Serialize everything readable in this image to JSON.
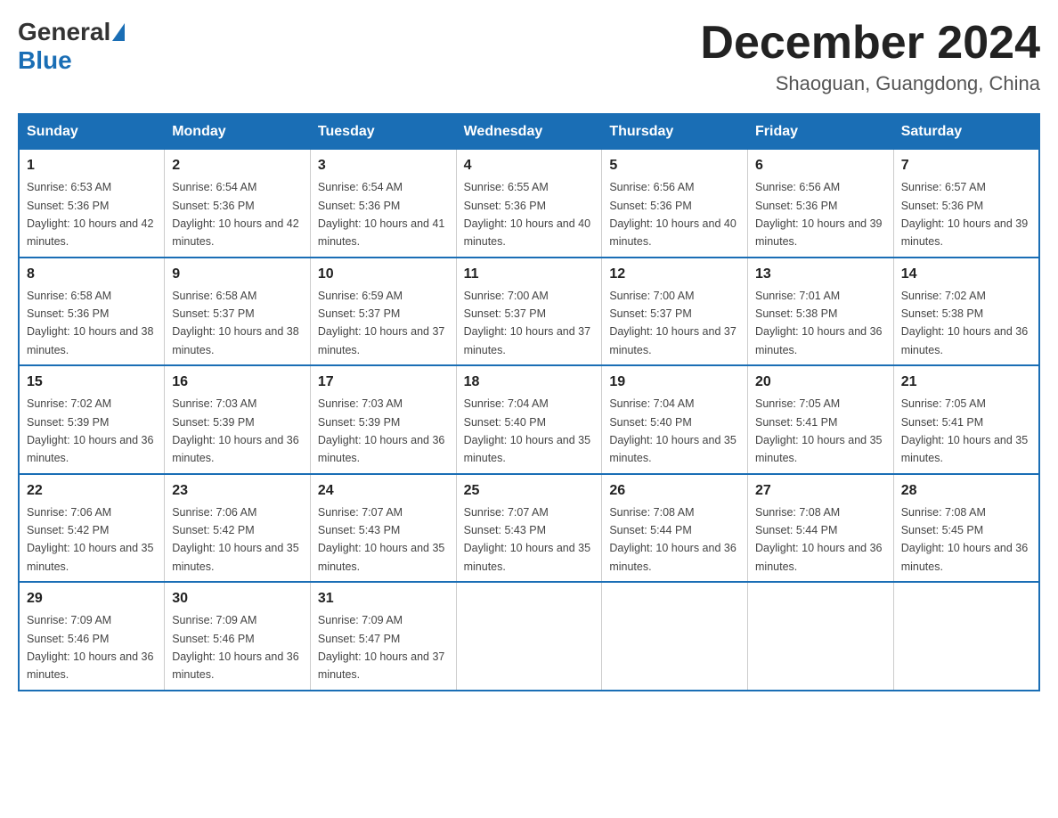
{
  "header": {
    "logo_general": "General",
    "logo_blue": "Blue",
    "title": "December 2024",
    "subtitle": "Shaoguan, Guangdong, China"
  },
  "days_of_week": [
    "Sunday",
    "Monday",
    "Tuesday",
    "Wednesday",
    "Thursday",
    "Friday",
    "Saturday"
  ],
  "weeks": [
    [
      {
        "day": "1",
        "sunrise": "6:53 AM",
        "sunset": "5:36 PM",
        "daylight": "10 hours and 42 minutes."
      },
      {
        "day": "2",
        "sunrise": "6:54 AM",
        "sunset": "5:36 PM",
        "daylight": "10 hours and 42 minutes."
      },
      {
        "day": "3",
        "sunrise": "6:54 AM",
        "sunset": "5:36 PM",
        "daylight": "10 hours and 41 minutes."
      },
      {
        "day": "4",
        "sunrise": "6:55 AM",
        "sunset": "5:36 PM",
        "daylight": "10 hours and 40 minutes."
      },
      {
        "day": "5",
        "sunrise": "6:56 AM",
        "sunset": "5:36 PM",
        "daylight": "10 hours and 40 minutes."
      },
      {
        "day": "6",
        "sunrise": "6:56 AM",
        "sunset": "5:36 PM",
        "daylight": "10 hours and 39 minutes."
      },
      {
        "day": "7",
        "sunrise": "6:57 AM",
        "sunset": "5:36 PM",
        "daylight": "10 hours and 39 minutes."
      }
    ],
    [
      {
        "day": "8",
        "sunrise": "6:58 AM",
        "sunset": "5:36 PM",
        "daylight": "10 hours and 38 minutes."
      },
      {
        "day": "9",
        "sunrise": "6:58 AM",
        "sunset": "5:37 PM",
        "daylight": "10 hours and 38 minutes."
      },
      {
        "day": "10",
        "sunrise": "6:59 AM",
        "sunset": "5:37 PM",
        "daylight": "10 hours and 37 minutes."
      },
      {
        "day": "11",
        "sunrise": "7:00 AM",
        "sunset": "5:37 PM",
        "daylight": "10 hours and 37 minutes."
      },
      {
        "day": "12",
        "sunrise": "7:00 AM",
        "sunset": "5:37 PM",
        "daylight": "10 hours and 37 minutes."
      },
      {
        "day": "13",
        "sunrise": "7:01 AM",
        "sunset": "5:38 PM",
        "daylight": "10 hours and 36 minutes."
      },
      {
        "day": "14",
        "sunrise": "7:02 AM",
        "sunset": "5:38 PM",
        "daylight": "10 hours and 36 minutes."
      }
    ],
    [
      {
        "day": "15",
        "sunrise": "7:02 AM",
        "sunset": "5:39 PM",
        "daylight": "10 hours and 36 minutes."
      },
      {
        "day": "16",
        "sunrise": "7:03 AM",
        "sunset": "5:39 PM",
        "daylight": "10 hours and 36 minutes."
      },
      {
        "day": "17",
        "sunrise": "7:03 AM",
        "sunset": "5:39 PM",
        "daylight": "10 hours and 36 minutes."
      },
      {
        "day": "18",
        "sunrise": "7:04 AM",
        "sunset": "5:40 PM",
        "daylight": "10 hours and 35 minutes."
      },
      {
        "day": "19",
        "sunrise": "7:04 AM",
        "sunset": "5:40 PM",
        "daylight": "10 hours and 35 minutes."
      },
      {
        "day": "20",
        "sunrise": "7:05 AM",
        "sunset": "5:41 PM",
        "daylight": "10 hours and 35 minutes."
      },
      {
        "day": "21",
        "sunrise": "7:05 AM",
        "sunset": "5:41 PM",
        "daylight": "10 hours and 35 minutes."
      }
    ],
    [
      {
        "day": "22",
        "sunrise": "7:06 AM",
        "sunset": "5:42 PM",
        "daylight": "10 hours and 35 minutes."
      },
      {
        "day": "23",
        "sunrise": "7:06 AM",
        "sunset": "5:42 PM",
        "daylight": "10 hours and 35 minutes."
      },
      {
        "day": "24",
        "sunrise": "7:07 AM",
        "sunset": "5:43 PM",
        "daylight": "10 hours and 35 minutes."
      },
      {
        "day": "25",
        "sunrise": "7:07 AM",
        "sunset": "5:43 PM",
        "daylight": "10 hours and 35 minutes."
      },
      {
        "day": "26",
        "sunrise": "7:08 AM",
        "sunset": "5:44 PM",
        "daylight": "10 hours and 36 minutes."
      },
      {
        "day": "27",
        "sunrise": "7:08 AM",
        "sunset": "5:44 PM",
        "daylight": "10 hours and 36 minutes."
      },
      {
        "day": "28",
        "sunrise": "7:08 AM",
        "sunset": "5:45 PM",
        "daylight": "10 hours and 36 minutes."
      }
    ],
    [
      {
        "day": "29",
        "sunrise": "7:09 AM",
        "sunset": "5:46 PM",
        "daylight": "10 hours and 36 minutes."
      },
      {
        "day": "30",
        "sunrise": "7:09 AM",
        "sunset": "5:46 PM",
        "daylight": "10 hours and 36 minutes."
      },
      {
        "day": "31",
        "sunrise": "7:09 AM",
        "sunset": "5:47 PM",
        "daylight": "10 hours and 37 minutes."
      },
      null,
      null,
      null,
      null
    ]
  ]
}
